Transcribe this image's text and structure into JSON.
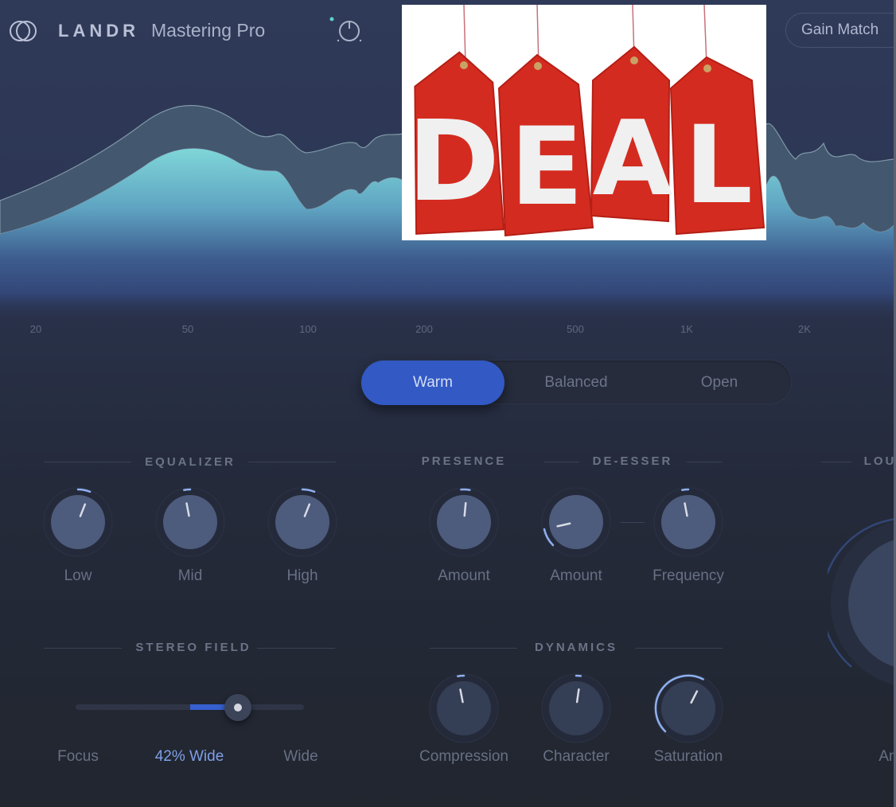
{
  "header": {
    "brand": "LANDR",
    "product": "Mastering Pro",
    "logo_icon": "interlocking-rings-icon",
    "power_icon": "power-knob-icon",
    "power_indicator_color": "#5fd0d0",
    "gain_match_label": "Gain Match"
  },
  "overlay": {
    "type": "advertisement-image",
    "letters": [
      "D",
      "E",
      "A",
      "L"
    ],
    "tag_color": "#d42b20"
  },
  "spectrum": {
    "freq_labels": [
      "20",
      "50",
      "100",
      "200",
      "500",
      "1K",
      "2K"
    ],
    "fill_color_top": "#7fd6d8",
    "fill_color_bottom": "#31457a"
  },
  "style_selector": {
    "options": [
      "Warm",
      "Balanced",
      "Open"
    ],
    "selected": "Warm",
    "accent": "#3259c4"
  },
  "sections": {
    "equalizer": {
      "title": "EQUALIZER",
      "knobs": [
        {
          "label": "Low",
          "value": 0.58
        },
        {
          "label": "Mid",
          "value": 0.46
        },
        {
          "label": "High",
          "value": 0.58
        }
      ]
    },
    "presence": {
      "title": "PRESENCE",
      "knobs": [
        {
          "label": "Amount",
          "value": 0.52
        }
      ]
    },
    "de_esser": {
      "title": "DE-ESSER",
      "knobs": [
        {
          "label": "Amount",
          "value": 0.12
        },
        {
          "label": "Frequency",
          "value": 0.46
        }
      ]
    },
    "loudness": {
      "title": "LOU",
      "knob_label": "An"
    },
    "stereo_field": {
      "title": "STEREO FIELD",
      "left_label": "Focus",
      "value_label": "42% Wide",
      "right_label": "Wide",
      "value_percent": 42
    },
    "dynamics": {
      "title": "DYNAMICS",
      "knobs": [
        {
          "label": "Compression",
          "value": 0.46
        },
        {
          "label": "Character",
          "value": 0.53
        },
        {
          "label": "Saturation",
          "value": 0.6
        }
      ]
    }
  }
}
